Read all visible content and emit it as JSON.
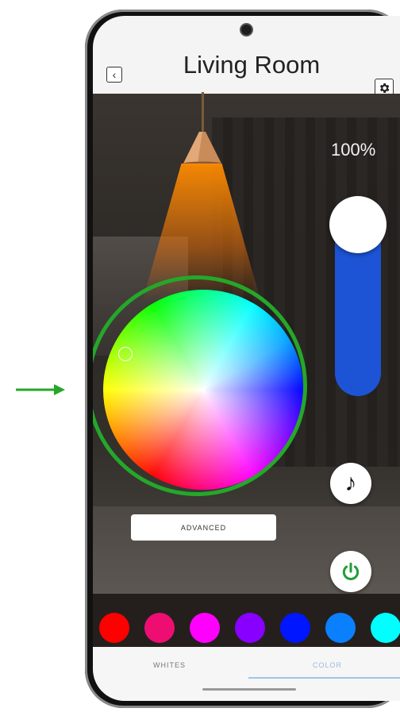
{
  "header": {
    "title": "Living Room"
  },
  "brightness": {
    "percent_label": "100%",
    "level": 1.0
  },
  "advanced_button": {
    "label": "ADVANCED"
  },
  "swatches": [
    "#ff0000",
    "#ee0e72",
    "#ff00ff",
    "#8800ff",
    "#0016ff",
    "#0a80ff",
    "#00ffff"
  ],
  "tabs": {
    "whites": "WHITES",
    "color": "COLOR",
    "active": "COLOR"
  },
  "icons": {
    "back": "chevron-left-icon",
    "settings": "gear-icon",
    "music": "music-note-icon",
    "power": "power-icon"
  },
  "colors": {
    "highlight_ring": "#25a72a",
    "slider_fill": "#1d54d6",
    "power_icon": "#1f9e3a",
    "beam": "#ff8c00"
  }
}
